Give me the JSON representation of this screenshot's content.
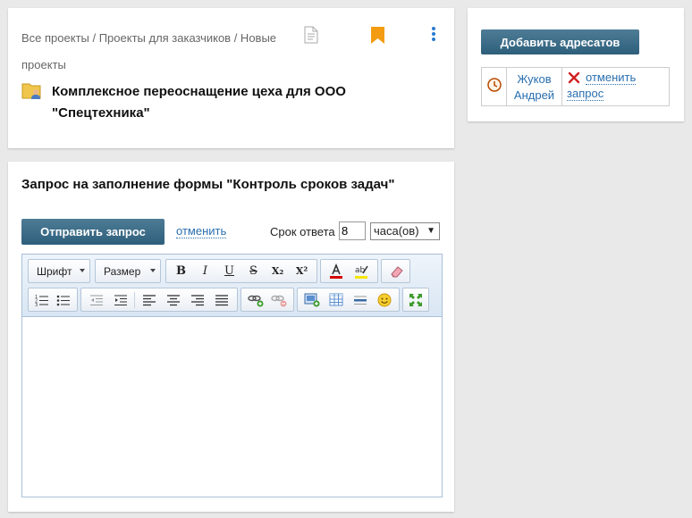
{
  "project": {
    "breadcrumb": "Все проекты / Проекты для заказчиков / Новые проекты",
    "title": "Комплексное переоснащение цеха для ООО \"Спецтехника\"",
    "icons": [
      "document-icon",
      "bookmark-icon",
      "more-vert-icon",
      "project-folder-icon"
    ]
  },
  "form": {
    "title": "Запрос на заполнение формы \"Контроль сроков задач\"",
    "send_label": "Отправить запрос",
    "cancel_label": "отменить",
    "deadline_label": "Срок ответа",
    "deadline_value": "8",
    "unit_value": "часа(ов)",
    "editor": {
      "font_label": "Шрифт",
      "size_label": "Размер",
      "format_buttons": [
        "B",
        "I",
        "U",
        "S",
        "X₂",
        "X²"
      ]
    }
  },
  "recipients": {
    "add_label": "Добавить адресатов",
    "rows": [
      {
        "name": "Жуков Андрей",
        "action_line1": "отменить",
        "action_line2": "запрос"
      }
    ]
  },
  "colors": {
    "button": "#2d5f7b",
    "link": "#2a6fb0",
    "bookmark": "#f39c12",
    "background": "#e9e9e9"
  }
}
